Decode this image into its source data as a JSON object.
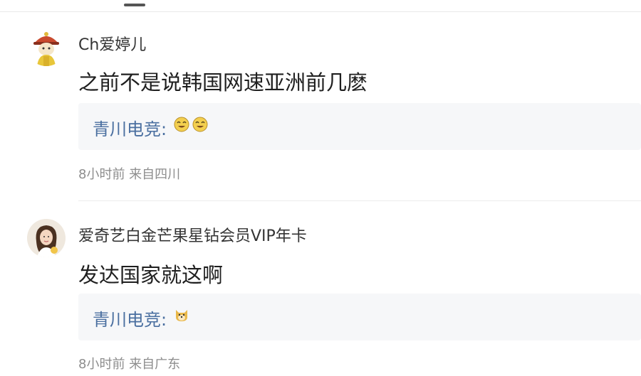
{
  "comments": [
    {
      "username": "Ch爱婷儿",
      "text": "之前不是说韩国网速亚洲前几麽",
      "reply": {
        "author": "青川电竞:",
        "emojis": [
          "laughing-emoji",
          "laughing-emoji"
        ]
      },
      "meta": "8小时前 来自四川",
      "avatar_icon": "cartoon-character-avatar"
    },
    {
      "username": "爱奇艺白金芒果星钻会员VIP年卡",
      "text": "发达国家就这啊",
      "reply": {
        "author": "青川电竞:",
        "emojis": [
          "doge-emoji"
        ]
      },
      "meta": "8小时前 来自广东",
      "avatar_icon": "woman-photo-avatar"
    }
  ],
  "colors": {
    "reply_author": "#4a6fa0",
    "meta_text": "#8d8d8d",
    "reply_bg": "#f6f7f9"
  }
}
